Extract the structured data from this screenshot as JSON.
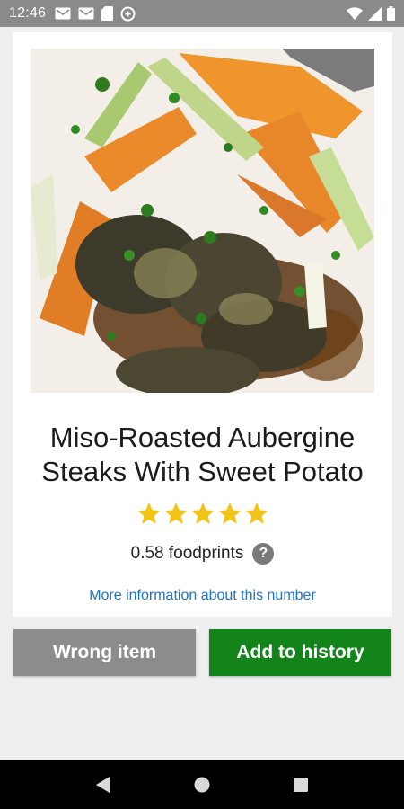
{
  "status_bar": {
    "time": "12:46",
    "left_icons": [
      "mail-icon",
      "mail-icon",
      "sd-card-icon",
      "data-saver-icon"
    ],
    "right_icons": [
      "wifi-icon",
      "signal-icon",
      "battery-icon"
    ]
  },
  "recipe": {
    "title": "Miso-Roasted Aubergine Steaks With Sweet Potato",
    "rating": 5,
    "rating_max": 5,
    "foodprint_text": "0.58 foodprints",
    "help_symbol": "?",
    "more_info_link": "More information about this number"
  },
  "actions": {
    "wrong_item_label": "Wrong item",
    "add_history_label": "Add to history"
  },
  "colors": {
    "status_bar": "#8a8a8a",
    "star": "#f2c319",
    "link": "#1e73c8",
    "wrong_button": "#8c8c8c",
    "add_button": "#12841a"
  },
  "nav_bar": {
    "buttons": [
      "back-icon",
      "home-icon",
      "recents-icon"
    ]
  }
}
